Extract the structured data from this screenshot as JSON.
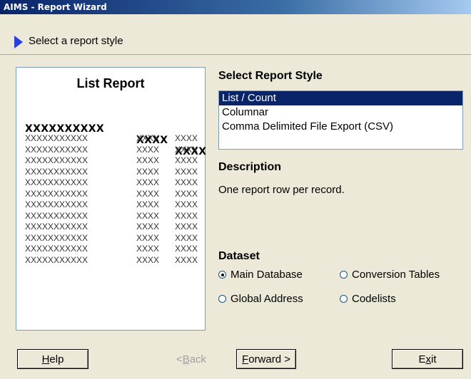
{
  "window": {
    "title": "AIMS - Report Wizard"
  },
  "step": {
    "label": "Select a report style"
  },
  "preview": {
    "title": "List Report",
    "header": [
      "XXXXXXXXXX",
      "XXXX",
      "XXXX"
    ],
    "rows": [
      [
        "XXXXXXXXXXX",
        "XXXX",
        "XXXX"
      ],
      [
        "XXXXXXXXXXX",
        "XXXX",
        "XXXX"
      ],
      [
        "XXXXXXXXXXX",
        "XXXX",
        "XXXX"
      ],
      [
        "XXXXXXXXXXX",
        "XXXX",
        "XXXX"
      ],
      [
        "XXXXXXXXXXX",
        "XXXX",
        "XXXX"
      ],
      [
        "XXXXXXXXXXX",
        "XXXX",
        "XXXX"
      ],
      [
        "XXXXXXXXXXX",
        "XXXX",
        "XXXX"
      ],
      [
        "XXXXXXXXXXX",
        "XXXX",
        "XXXX"
      ],
      [
        "XXXXXXXXXXX",
        "XXXX",
        "XXXX"
      ],
      [
        "XXXXXXXXXXX",
        "XXXX",
        "XXXX"
      ],
      [
        "XXXXXXXXXXX",
        "XXXX",
        "XXXX"
      ],
      [
        "XXXXXXXXXXX",
        "XXXX",
        "XXXX"
      ]
    ]
  },
  "style_section": {
    "label": "Select Report Style",
    "options": [
      "List / Count",
      "Columnar",
      "Comma Delimited File Export (CSV)"
    ],
    "selected_index": 0
  },
  "description": {
    "label": "Description",
    "text": "One report row per record."
  },
  "dataset": {
    "label": "Dataset",
    "options": [
      {
        "label": "Main Database",
        "checked": true
      },
      {
        "label": "Conversion Tables",
        "checked": false
      },
      {
        "label": "Global Address",
        "checked": false
      },
      {
        "label": "Codelists",
        "checked": false
      }
    ]
  },
  "buttons": {
    "help": {
      "pre": "",
      "mnemonic": "H",
      "post": "elp"
    },
    "back": {
      "pre": "< ",
      "mnemonic": "B",
      "post": "ack"
    },
    "forward": {
      "pre": "",
      "mnemonic": "F",
      "post": "orward >"
    },
    "exit": {
      "pre": "E",
      "mnemonic": "x",
      "post": "it"
    }
  },
  "colors": {
    "selection": "#0A246A",
    "step_arrow": "#2B3FDB",
    "dialog_bg": "#ECE9D8"
  }
}
